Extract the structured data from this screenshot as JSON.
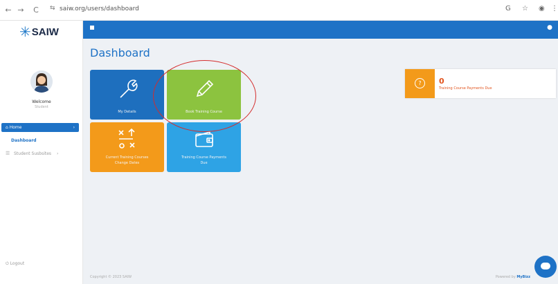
{
  "browser": {
    "url": "saiw.org/users/dashboard",
    "back": "←",
    "forward": "→",
    "reload": "C",
    "tune": "⇆"
  },
  "sidebar": {
    "logo_text": "SAIW",
    "welcome": "Welcome",
    "welcome_sub": "Student",
    "home_label": "Home",
    "home_chevron": "›",
    "dashboard_label": "Dashboard",
    "student_label": "Student Susbsites",
    "student_chevron": "›",
    "logout_label": "Logout"
  },
  "header": {
    "title": "Dashboard"
  },
  "tiles": [
    {
      "label": "My Details",
      "color": "#1e6fbe",
      "icon": "wrench-icon"
    },
    {
      "label": "Book Training Course",
      "color": "#8cc33f",
      "icon": "pencil-icon"
    },
    {
      "label": "Current Training Courses Change Dates",
      "line1": "Current Training Courses",
      "line2": "Change Dates",
      "color": "#f39a1a",
      "icon": "swap-arrows-icon"
    },
    {
      "label": "Training Course Payments Due",
      "line1": "Training Course Payments",
      "line2": "Due",
      "color": "#2ea3e5",
      "icon": "wallet-icon"
    }
  ],
  "stat_card": {
    "value": "0",
    "label": "Training Course Payments Due",
    "icon_glyph": "?",
    "color": "#f39a1a"
  },
  "footer": {
    "copyright": "Copyright © 2023 SAIW",
    "powered_by": "Powered by",
    "brand": "MyBizz"
  },
  "colors": {
    "primary": "#1e72c6",
    "accent_orange": "#f39a1a",
    "accent_green": "#8cc33f",
    "accent_light_blue": "#2ea3e5",
    "annotation_red": "#d42c2c"
  }
}
